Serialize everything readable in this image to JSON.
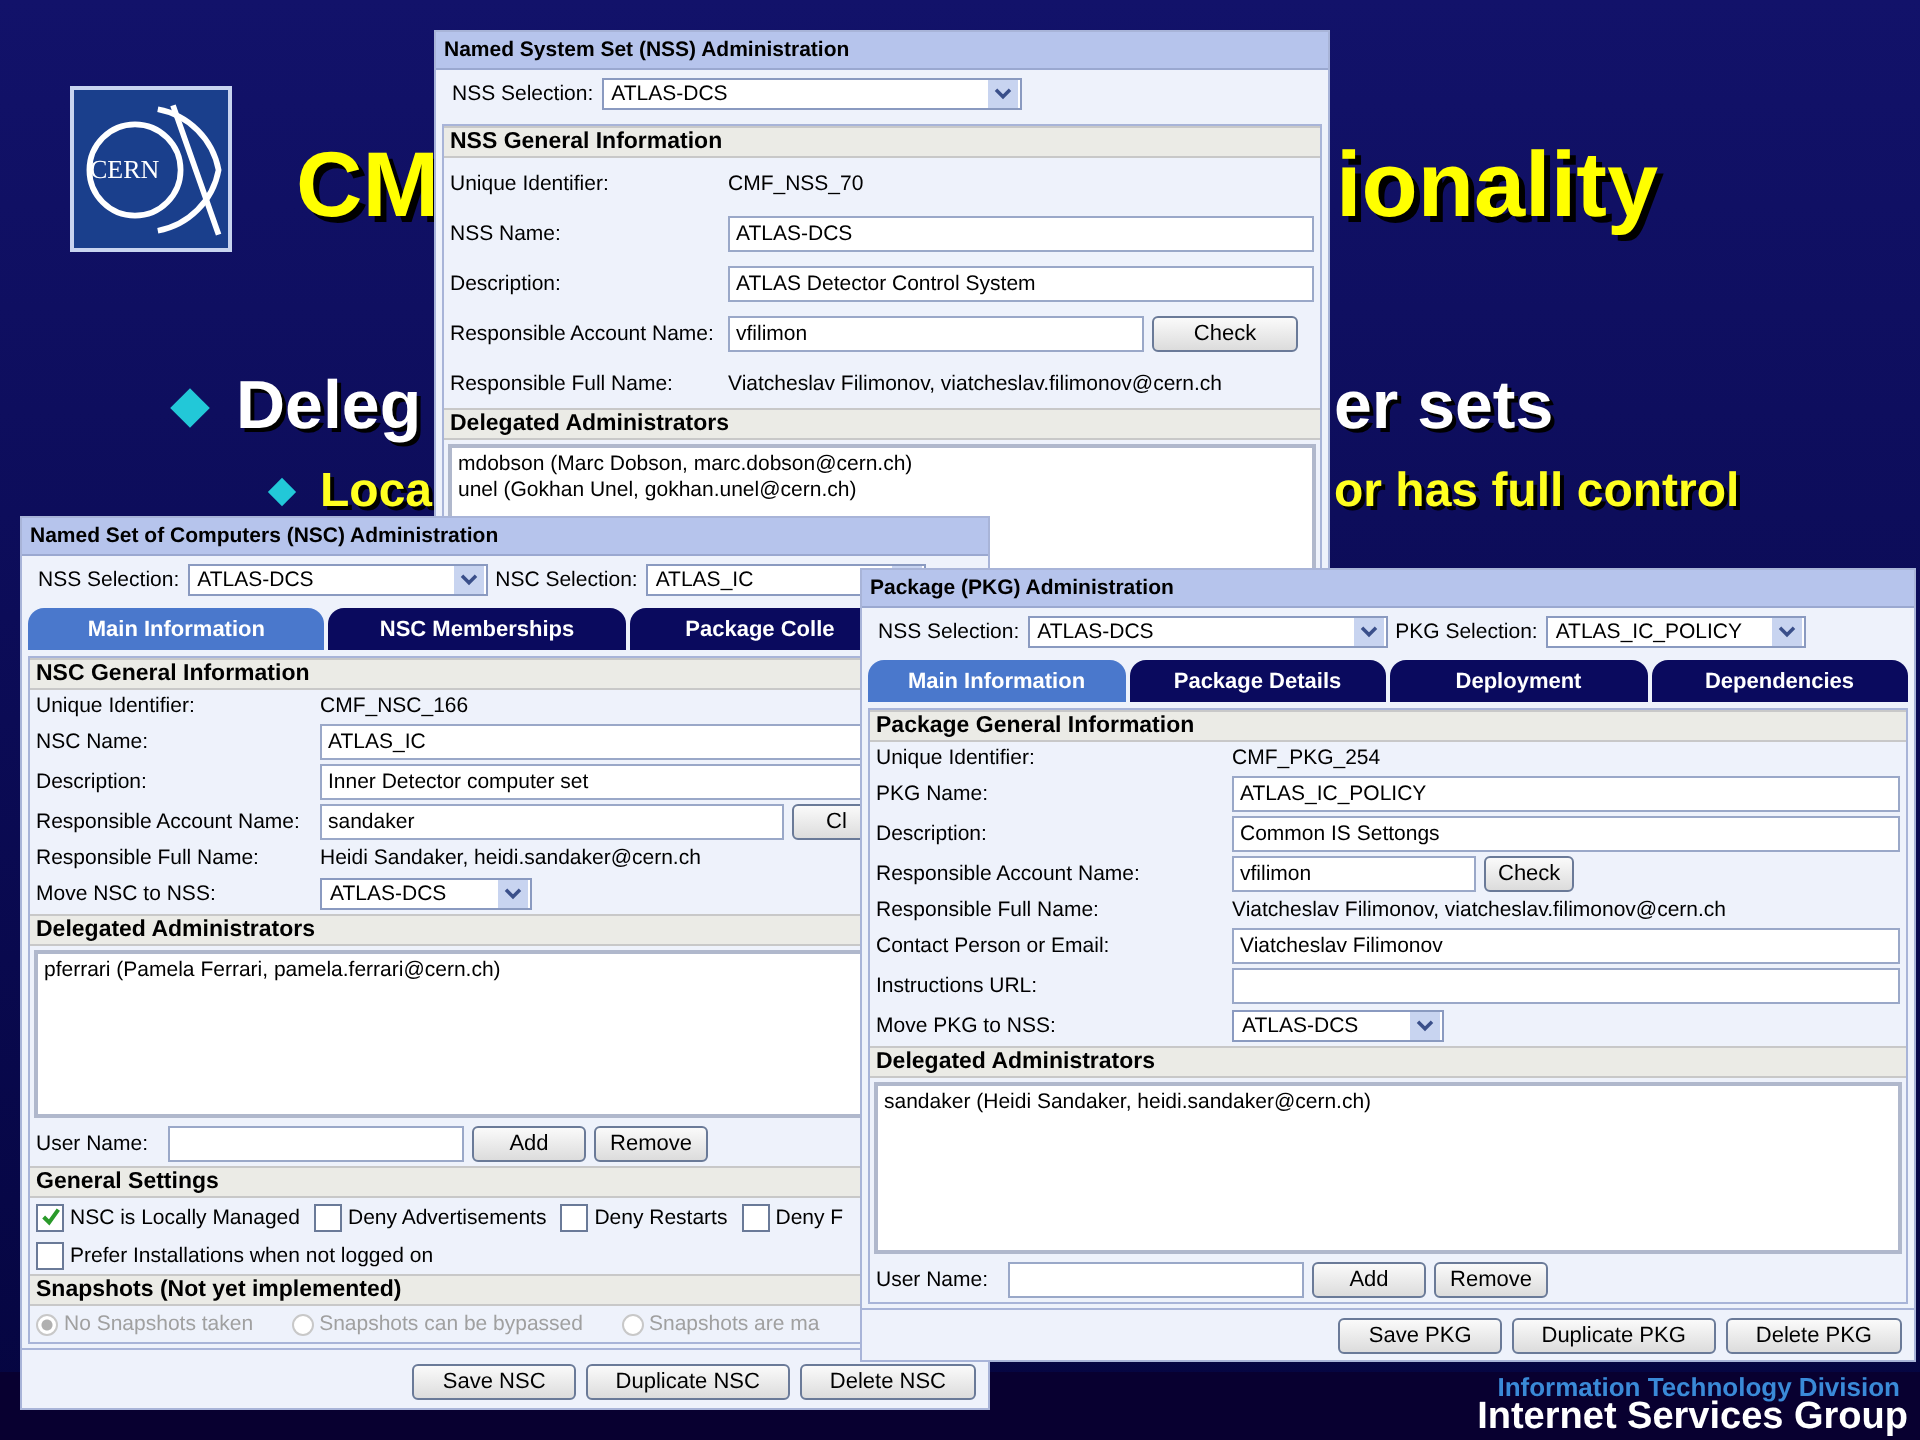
{
  "slide": {
    "logo_text": "CERN",
    "title_parts": [
      "CM",
      "ionality"
    ],
    "bullet_1_parts": [
      "Deleg",
      "er sets"
    ],
    "bullet_2_parts": [
      "Loca",
      "or has full control"
    ],
    "footer": {
      "division": "Information Technology Division",
      "group": "Internet Services Group"
    }
  },
  "windows": [
    {
      "title": "Named System Set (NSS) Administration",
      "selectors": [
        {
          "label": "NSS Selection:",
          "value": "ATLAS-DCS"
        }
      ],
      "sections": [
        {
          "kind": "form",
          "heading": "NSS General Information",
          "rows": [
            {
              "kind": "text",
              "label": "Unique Identifier:",
              "value": "CMF_NSS_70"
            },
            {
              "kind": "field",
              "label": "NSS Name:",
              "value": "ATLAS-DCS"
            },
            {
              "kind": "field",
              "label": "Description:",
              "value": "ATLAS Detector Control System"
            },
            {
              "kind": "field_check",
              "label": "Responsible Account Name:",
              "value": "vfilimon",
              "button": "Check"
            },
            {
              "kind": "text",
              "label": "Responsible Full Name:",
              "value": "Viatcheslav Filimonov, viatcheslav.filimonov@cern.ch"
            }
          ]
        },
        {
          "kind": "list",
          "heading": "Delegated Administrators",
          "entries": [
            "mdobson (Marc Dobson, marc.dobson@cern.ch)",
            "unel (Gokhan Unel, gokhan.unel@cern.ch)"
          ]
        }
      ]
    },
    {
      "title": "Named Set of Computers (NSC) Administration",
      "selectors": [
        {
          "label": "NSS Selection:",
          "value": "ATLAS-DCS"
        },
        {
          "label": "NSC Selection:",
          "value": "ATLAS_IC"
        }
      ],
      "tabs": [
        {
          "label": "Main Information",
          "selected": true
        },
        {
          "label": "NSC Memberships",
          "selected": false
        },
        {
          "label": "Package Colle",
          "selected": false
        }
      ],
      "sections": [
        {
          "kind": "form",
          "heading": "NSC General Information",
          "rows": [
            {
              "kind": "text",
              "label": "Unique Identifier:",
              "value": "CMF_NSC_166"
            },
            {
              "kind": "field",
              "label": "NSC Name:",
              "value": "ATLAS_IC"
            },
            {
              "kind": "field",
              "label": "Description:",
              "value": "Inner Detector computer set"
            },
            {
              "kind": "field_check",
              "label": "Responsible Account Name:",
              "value": "sandaker",
              "button": "Cl"
            },
            {
              "kind": "text",
              "label": "Responsible Full Name:",
              "value": "Heidi Sandaker, heidi.sandaker@cern.ch"
            },
            {
              "kind": "dropdown",
              "label": "Move NSC to NSS:",
              "value": "ATLAS-DCS"
            }
          ]
        },
        {
          "kind": "list",
          "heading": "Delegated Administrators",
          "entries": [
            "pferrari (Pamela Ferrari, pamela.ferrari@cern.ch)"
          ],
          "user_label": "User Name:",
          "buttons": [
            "Add",
            "Remove"
          ]
        },
        {
          "kind": "checks",
          "heading": "General Settings",
          "rows": [
            {
              "items": [
                {
                  "label": "NSC is Locally Managed",
                  "checked": true
                },
                {
                  "label": "Deny Advertisements",
                  "checked": false
                },
                {
                  "label": "Deny Restarts",
                  "checked": false
                },
                {
                  "label": "Deny F",
                  "checked": false
                }
              ]
            },
            {
              "items": [
                {
                  "label": "Prefer Installations when not logged on",
                  "checked": false
                }
              ]
            }
          ]
        },
        {
          "kind": "radios",
          "heading": "Snapshots (Not yet implemented)",
          "disabled": true,
          "options": [
            {
              "label": "No Snapshots taken",
              "selected": true
            },
            {
              "label": "Snapshots can be bypassed",
              "selected": false
            },
            {
              "label": "Snapshots are ma",
              "selected": false
            }
          ]
        }
      ],
      "buttons": [
        "Save NSC",
        "Duplicate NSC",
        "Delete NSC"
      ]
    },
    {
      "title": "Package (PKG) Administration",
      "selectors": [
        {
          "label": "NSS Selection:",
          "value": "ATLAS-DCS"
        },
        {
          "label": "PKG Selection:",
          "value": "ATLAS_IC_POLICY"
        }
      ],
      "tabs": [
        {
          "label": "Main Information",
          "selected": true
        },
        {
          "label": "Package Details",
          "selected": false
        },
        {
          "label": "Deployment",
          "selected": false
        },
        {
          "label": "Dependencies",
          "selected": false
        }
      ],
      "sections": [
        {
          "kind": "form",
          "heading": "Package General Information",
          "rows": [
            {
              "kind": "text",
              "label": "Unique Identifier:",
              "value": "CMF_PKG_254"
            },
            {
              "kind": "field",
              "label": "PKG Name:",
              "value": "ATLAS_IC_POLICY"
            },
            {
              "kind": "field",
              "label": "Description:",
              "value": "Common IS Settongs"
            },
            {
              "kind": "field_check",
              "label": "Responsible Account Name:",
              "value": "vfilimon",
              "button": "Check"
            },
            {
              "kind": "text",
              "label": "Responsible Full Name:",
              "value": "Viatcheslav Filimonov, viatcheslav.filimonov@cern.ch"
            },
            {
              "kind": "field",
              "label": "Contact Person or Email:",
              "value": "Viatcheslav Filimonov"
            },
            {
              "kind": "field",
              "label": "Instructions URL:"
            },
            {
              "kind": "dropdown",
              "label": "Move PKG to NSS:",
              "value": "ATLAS-DCS"
            }
          ]
        },
        {
          "kind": "list",
          "heading": "Delegated Administrators",
          "entries": [
            "sandaker (Heidi Sandaker, heidi.sandaker@cern.ch)"
          ],
          "user_label": "User Name:",
          "buttons": [
            "Add",
            "Remove"
          ]
        }
      ],
      "buttons": [
        "Save PKG",
        "Duplicate PKG",
        "Delete PKG"
      ]
    }
  ]
}
